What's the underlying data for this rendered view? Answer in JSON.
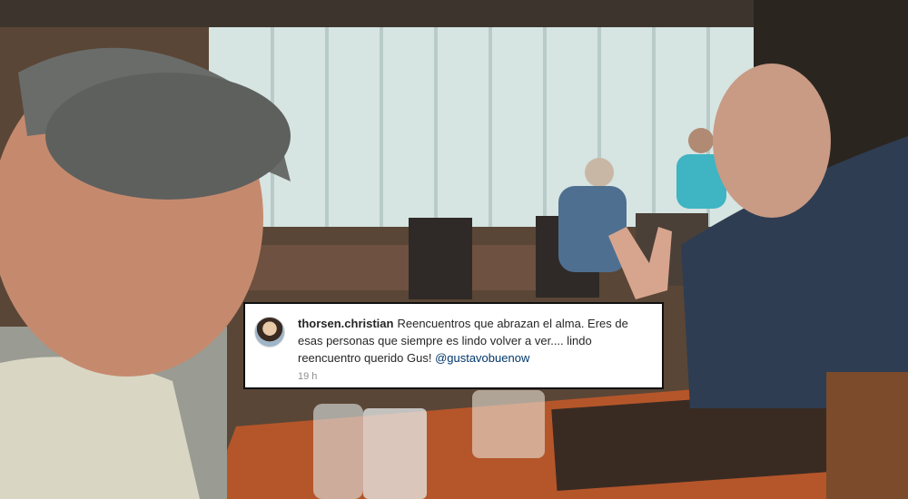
{
  "photo": {
    "description_icon": "photo-selfie",
    "colors": {
      "window": "#cfe0df",
      "wall": "#5a4636",
      "table": "#b5562a",
      "shirt": "#2f3d52"
    }
  },
  "comment": {
    "username": "thorsen.christian",
    "text": "Reencuentros que abrazan el alma. Eres de esas personas que siempre es lindo volver a ver.... lindo reencuentro querido Gus!",
    "mention": "@gustavobuenow",
    "timestamp": "19 h"
  }
}
